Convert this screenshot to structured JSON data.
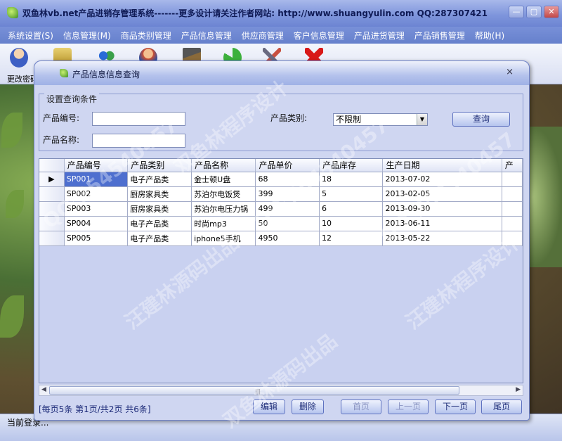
{
  "main_window": {
    "title": "双鱼林vb.net产品进销存管理系统-------更多设计请关注作者网站: http://www.shuangyulin.com QQ:287307421",
    "buttons": [
      "—",
      "▢",
      "✕"
    ]
  },
  "menu": [
    "系统设置(S)",
    "信息管理(M)",
    "商品类别管理",
    "产品信息管理",
    "供应商管理",
    "客户信息管理",
    "产品进货管理",
    "产品销售管理",
    "帮助(H)"
  ],
  "toolbar": {
    "first_label": "更改密码",
    "icons": [
      "user-icon",
      "lock-icon",
      "users-icon",
      "customer-icon",
      "home-icon",
      "refresh-icon",
      "tools-icon",
      "exit-icon"
    ]
  },
  "status": {
    "text": "当前登录..."
  },
  "dialog": {
    "title": "产品信息信息查询",
    "close": "×",
    "condition_legend": "设置查询条件",
    "product_code_label": "产品编号:",
    "product_code_value": "",
    "product_name_label": "产品名称:",
    "product_name_value": "",
    "category_label": "产品类别:",
    "category_value": "不限制",
    "query_button": "查询"
  },
  "grid": {
    "columns": [
      "产品编号",
      "产品类别",
      "产品名称",
      "产品单价",
      "产品库存",
      "生产日期",
      "产"
    ],
    "rows": [
      [
        "SP001",
        "电子产品类",
        "金士顿U盘",
        "68",
        "18",
        "2013-07-02"
      ],
      [
        "SP002",
        "厨房家具类",
        "苏泊尔电饭煲",
        "399",
        "5",
        "2013-02-05"
      ],
      [
        "SP003",
        "厨房家具类",
        "苏泊尔电压力锅",
        "499",
        "6",
        "2013-09-30"
      ],
      [
        "SP004",
        "电子产品类",
        "时尚mp3",
        "50",
        "10",
        "2013-06-11"
      ],
      [
        "SP005",
        "电子产品类",
        "iphone5手机",
        "4950",
        "12",
        "2013-05-22"
      ]
    ],
    "current_row_marker": "▶"
  },
  "pager": {
    "info": "[每页5条 第1页/共2页   共6条]",
    "edit": "编辑",
    "delete": "删除",
    "first": "首页",
    "prev": "上一页",
    "next": "下一页",
    "last": "尾页"
  },
  "watermarks": [
    "QQ:254540457",
    "双鱼林程序设计",
    "汪建林源码出品",
    "QQ:254540457",
    "双鱼林源码出品",
    "汪建林程序设计",
    "QQ:254540457"
  ]
}
